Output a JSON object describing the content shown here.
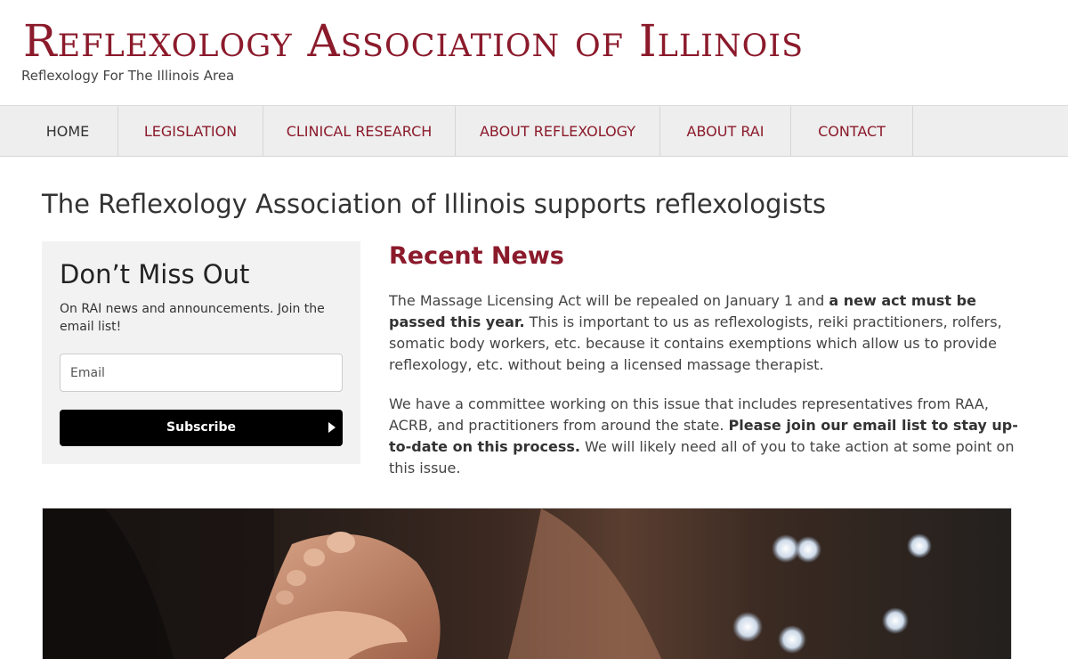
{
  "header": {
    "site_title": "Reflexology Association of Illinois",
    "tagline": "Reflexology For The Illinois Area"
  },
  "nav": {
    "items": [
      {
        "label": "HOME"
      },
      {
        "label": "LEGISLATION"
      },
      {
        "label": "CLINICAL RESEARCH"
      },
      {
        "label": "ABOUT REFLEXOLOGY"
      },
      {
        "label": "ABOUT RAI"
      },
      {
        "label": "CONTACT"
      }
    ]
  },
  "main": {
    "heading": "The Reflexology Association of Illinois supports reflexologists"
  },
  "signup": {
    "title": "Don’t Miss Out",
    "text": "On RAI news and announcements. Join the email list!",
    "email_placeholder": "Email",
    "subscribe_label": "Subscribe"
  },
  "news": {
    "title": "Recent News",
    "p1_a": "The Massage Licensing Act will be repealed on January 1 and ",
    "p1_b": "a new act must be passed this year.",
    "p1_c": " This is important to us as reflexologists, reiki practitioners, rolfers, somatic body workers, etc. because it contains exemptions which allow us to provide reflexology, etc. without being a licensed massage therapist.",
    "p2_a": "We have a committee working on this issue that includes representatives from RAA, ACRB, and practitioners from around the state. ",
    "p2_b": "Please join our email list to stay up-to-date on this process.",
    "p2_c": " We will likely need all of you to take action at some point on this issue."
  },
  "colors": {
    "brand": "#8b1a2b",
    "nav_background": "#eeeeee",
    "signup_background": "#f2f2f2",
    "button": "#000000"
  }
}
